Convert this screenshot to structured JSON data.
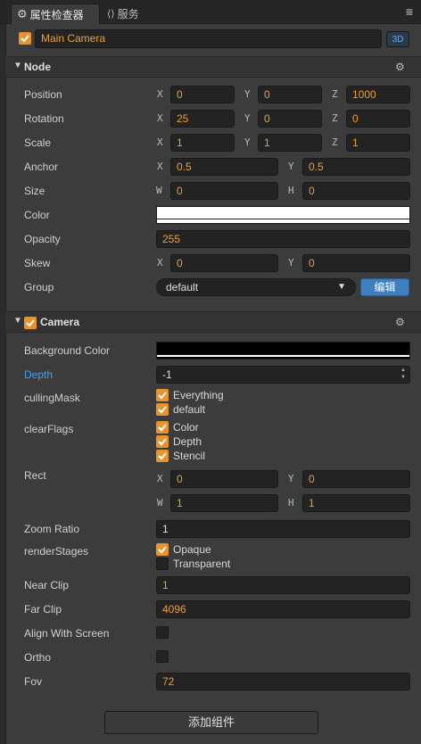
{
  "tabs": {
    "inspector_label": "属性检查器",
    "services_label": "服务"
  },
  "node_header": {
    "node_name": "Main Camera",
    "mode_badge": "3D"
  },
  "node_section": {
    "title": "Node",
    "position": {
      "label": "Position",
      "x_axis": "X",
      "y_axis": "Y",
      "z_axis": "Z",
      "x": "0",
      "y": "0",
      "z": "1000"
    },
    "rotation": {
      "label": "Rotation",
      "x_axis": "X",
      "y_axis": "Y",
      "z_axis": "Z",
      "x": "25",
      "y": "0",
      "z": "0"
    },
    "scale": {
      "label": "Scale",
      "x_axis": "X",
      "y_axis": "Y",
      "z_axis": "Z",
      "x": "1",
      "y": "1",
      "z": "1"
    },
    "anchor": {
      "label": "Anchor",
      "x_axis": "X",
      "y_axis": "Y",
      "x": "0.5",
      "y": "0.5"
    },
    "size": {
      "label": "Size",
      "w_axis": "W",
      "h_axis": "H",
      "w": "0",
      "h": "0"
    },
    "color": {
      "label": "Color",
      "value": "#ffffff"
    },
    "opacity": {
      "label": "Opacity",
      "value": "255"
    },
    "skew": {
      "label": "Skew",
      "x_axis": "X",
      "y_axis": "Y",
      "x": "0",
      "y": "0"
    },
    "group": {
      "label": "Group",
      "value": "default",
      "edit_button": "编辑"
    }
  },
  "camera_section": {
    "title": "Camera",
    "background_color": {
      "label": "Background Color",
      "value": "#000000"
    },
    "depth": {
      "label": "Depth",
      "value": "-1"
    },
    "culling_mask": {
      "label": "cullingMask",
      "options": [
        "Everything",
        "default"
      ]
    },
    "clear_flags": {
      "label": "clearFlags",
      "options": [
        "Color",
        "Depth",
        "Stencil"
      ]
    },
    "rect": {
      "label": "Rect",
      "x_axis": "X",
      "y_axis": "Y",
      "w_axis": "W",
      "h_axis": "H",
      "x": "0",
      "y": "0",
      "w": "1",
      "h": "1"
    },
    "zoom_ratio": {
      "label": "Zoom Ratio",
      "value": "1"
    },
    "render_stages": {
      "label": "renderStages",
      "options": [
        "Opaque",
        "Transparent"
      ],
      "checked": [
        true,
        false
      ]
    },
    "near_clip": {
      "label": "Near Clip",
      "value": "1"
    },
    "far_clip": {
      "label": "Far Clip",
      "value": "4096"
    },
    "align_with_screen": {
      "label": "Align With Screen",
      "checked": false
    },
    "ortho": {
      "label": "Ortho",
      "checked": false
    },
    "fov": {
      "label": "Fov",
      "value": "72"
    }
  },
  "add_component_label": "添加组件",
  "colors": {
    "accent": "#e8942b",
    "value_text": "#f0a030",
    "highlight_label": "#4a9fe8",
    "button_blue": "#3f7fbf"
  }
}
